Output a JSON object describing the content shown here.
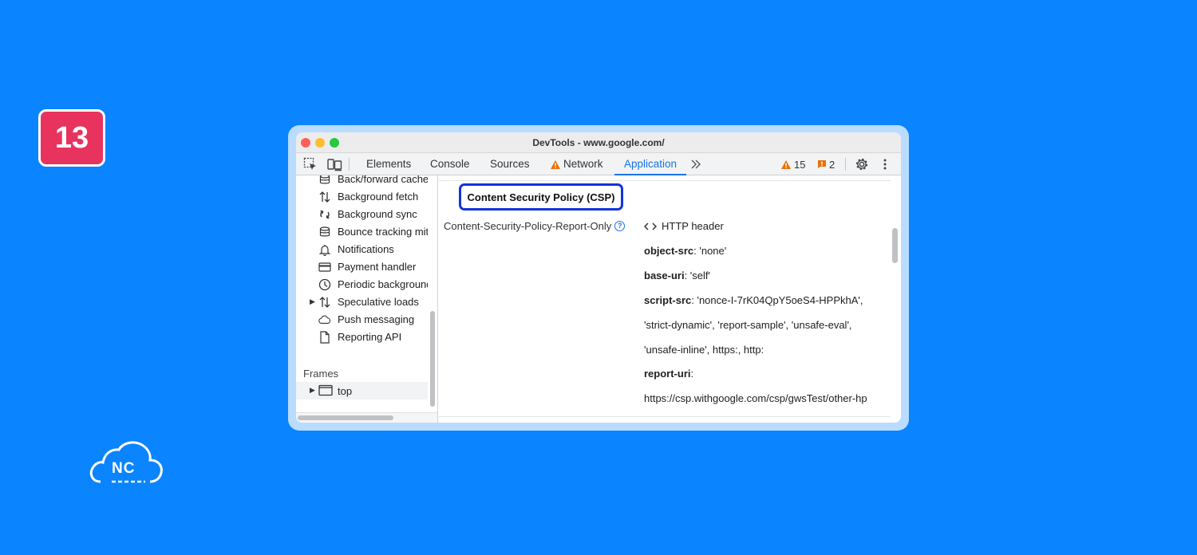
{
  "step_badge": "13",
  "logo": {
    "text": "NC"
  },
  "window": {
    "title": "DevTools - www.google.com/"
  },
  "toolbar": {
    "tabs": [
      {
        "label": "Elements"
      },
      {
        "label": "Console"
      },
      {
        "label": "Sources"
      },
      {
        "label": "Network"
      },
      {
        "label": "Application"
      }
    ],
    "more_tabs_label": ">>",
    "warnings_count": "15",
    "issues_count": "2"
  },
  "sidebar": {
    "items": [
      {
        "label": "Back/forward cache",
        "icon": "database-icon"
      },
      {
        "label": "Background fetch",
        "icon": "arrows-updown-icon"
      },
      {
        "label": "Background sync",
        "icon": "sync-icon"
      },
      {
        "label": "Bounce tracking mitigations",
        "icon": "database-icon"
      },
      {
        "label": "Notifications",
        "icon": "bell-icon"
      },
      {
        "label": "Payment handler",
        "icon": "card-icon"
      },
      {
        "label": "Periodic background sync",
        "icon": "clock-icon"
      },
      {
        "label": "Speculative loads",
        "icon": "arrows-updown-icon"
      },
      {
        "label": "Push messaging",
        "icon": "cloud-icon"
      },
      {
        "label": "Reporting API",
        "icon": "file-icon"
      }
    ],
    "frames_heading": "Frames",
    "frames_top": "top"
  },
  "main": {
    "section_title": "Content Security Policy (CSP)",
    "policy_name": "Content-Security-Policy-Report-Only",
    "source": "HTTP header",
    "directives": {
      "object_src_key": "object-src",
      "object_src_value": ": 'none'",
      "base_uri_key": "base-uri",
      "base_uri_value": ": 'self'",
      "script_src_key": "script-src",
      "script_src_value_1": ": 'nonce-I-7rK04QpY5oeS4-HPPkhA',",
      "script_src_value_2": "'strict-dynamic', 'report-sample', 'unsafe-eval',",
      "script_src_value_3": "'unsafe-inline', https:, http:",
      "report_uri_key": "report-uri",
      "report_uri_colon": ":",
      "report_uri_value": "https://csp.withgoogle.com/csp/gwsTest/other-hp"
    }
  }
}
